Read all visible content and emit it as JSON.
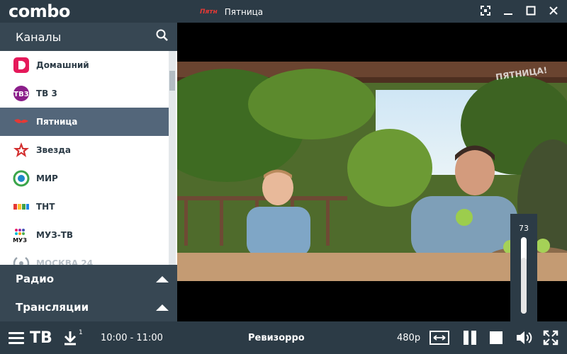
{
  "app": {
    "logo": "combo",
    "current_channel_logo": "Пятн",
    "current_channel": "Пятница"
  },
  "sidebar": {
    "title": "Каналы",
    "channels": [
      {
        "name": "Домашний",
        "icon": "domashniy-logo",
        "color": "#e5195a"
      },
      {
        "name": "ТВ 3",
        "icon": "tv3-logo",
        "color": "#8b1e8a"
      },
      {
        "name": "Пятница",
        "icon": "pyatnitsa-logo",
        "color": "#e53935"
      },
      {
        "name": "Звезда",
        "icon": "zvezda-logo",
        "color": "#d32f2f"
      },
      {
        "name": "МИР",
        "icon": "mir-logo",
        "color": "#3aa54a"
      },
      {
        "name": "ТНТ",
        "icon": "tnt-logo",
        "color": "#6c6c6c"
      },
      {
        "name": "МУЗ-ТВ",
        "icon": "muztv-logo",
        "color": "#8e24aa"
      },
      {
        "name": "МОСКВА 24",
        "icon": "moskva24-logo",
        "color": "#9aa4ad"
      }
    ],
    "active_index": 2,
    "sections": [
      {
        "label": "Радио"
      },
      {
        "label": "Трансляции"
      }
    ]
  },
  "video": {
    "watermark": "ПЯТНИЦА!"
  },
  "volume": {
    "value": "73",
    "level": 0.73
  },
  "bottombar": {
    "tv_label": "ТВ",
    "download_badge": "1",
    "time": "10:00 - 11:00",
    "program": "Ревизорро",
    "quality": "480p"
  },
  "colors": {
    "panel": "#2c3b46",
    "header": "#374753",
    "active": "#53667a",
    "accent_red": "#e53935"
  }
}
